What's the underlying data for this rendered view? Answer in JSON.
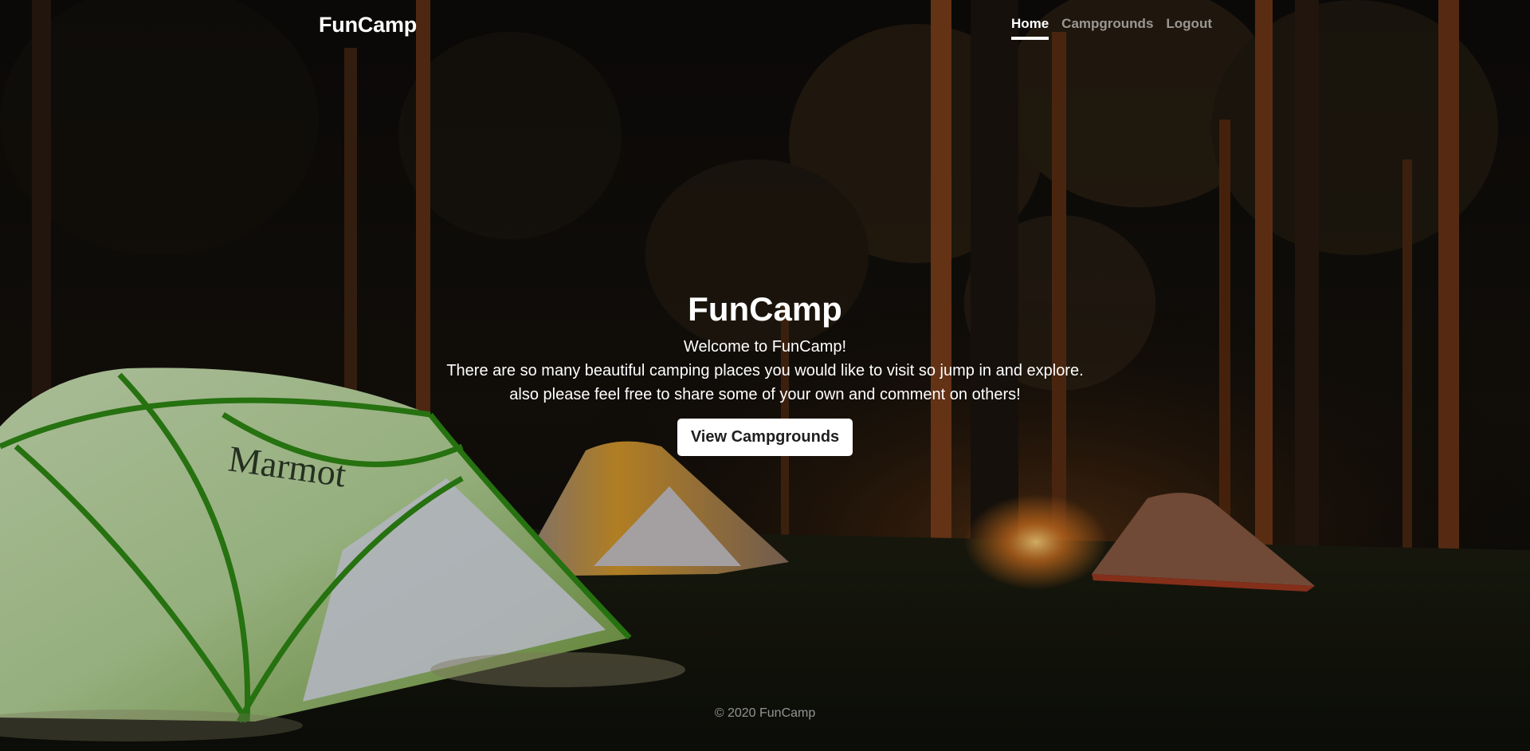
{
  "brand": "FunCamp",
  "nav": {
    "items": [
      {
        "label": "Home",
        "active": true
      },
      {
        "label": "Campgrounds",
        "active": false
      },
      {
        "label": "Logout",
        "active": false
      }
    ]
  },
  "hero": {
    "title": "FunCamp",
    "lines": [
      "Welcome to FunCamp!",
      "There are so many beautiful camping places you would like to visit so jump in and explore.",
      "also please feel free to share some of your own and comment on others!"
    ],
    "button_label": "View Campgrounds"
  },
  "footer": {
    "text": "© 2020 FunCamp"
  },
  "colors": {
    "text": "#ffffff",
    "muted": "#8c8c8c",
    "button_bg": "#ffffff",
    "button_text": "#1f1f1f"
  }
}
